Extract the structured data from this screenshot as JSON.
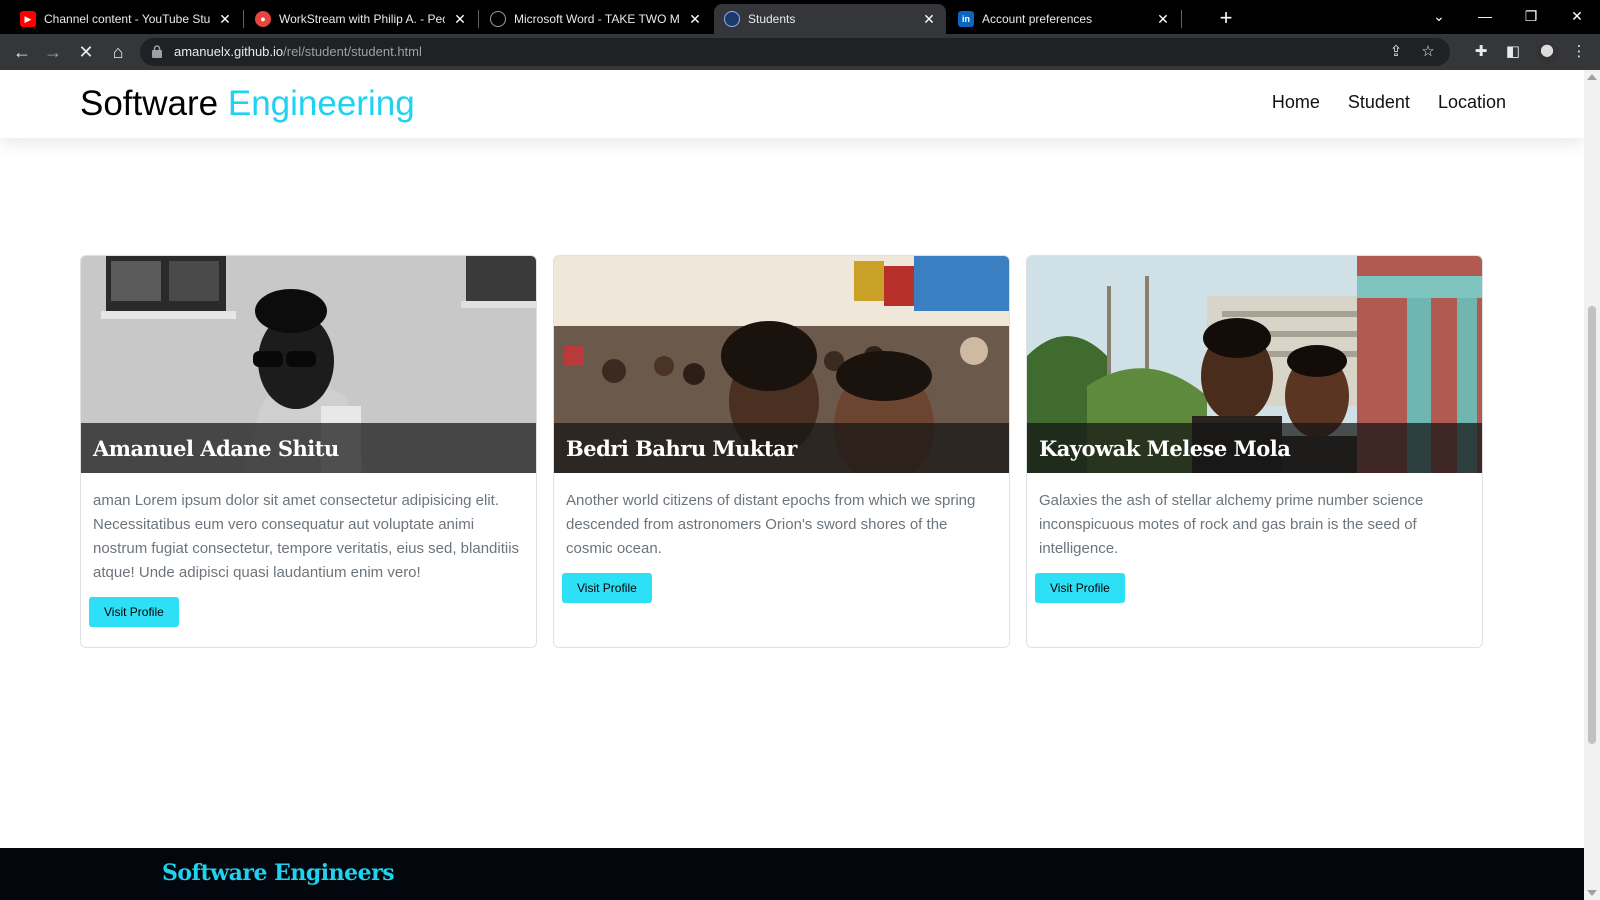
{
  "browser": {
    "tabs": [
      {
        "title": "Channel content - YouTube Studio",
        "favicon": "youtube-icon",
        "color": "#ff0000",
        "active": false
      },
      {
        "title": "WorkStream with Philip A. - People",
        "favicon": "workstream-icon",
        "color": "#e8453c",
        "active": false
      },
      {
        "title": "Microsoft Word - TAKE TWO MAIN",
        "favicon": "globe-icon",
        "color": "#9aa0a6",
        "active": false
      },
      {
        "title": "Students",
        "favicon": "page-icon",
        "color": "#8ab4f8",
        "active": true
      },
      {
        "title": "Account preferences",
        "favicon": "linkedin-icon",
        "color": "#0a66c2",
        "active": false
      }
    ],
    "url_host": "amanuelx.github.io",
    "url_path": "/rel/student/student.html"
  },
  "site": {
    "brand_main": "Software",
    "brand_accent": "Engineering",
    "accent_color": "#1ed2f0",
    "nav": [
      "Home",
      "Student",
      "Location"
    ]
  },
  "students": [
    {
      "name": "Amanuel Adane Shitu",
      "bio": "aman Lorem ipsum dolor sit amet consectetur adipisicing elit. Necessitatibus eum vero consequatur aut voluptate animi nostrum fugiat consectetur, tempore veritatis, eius sed, blanditiis atque! Unde adipisci quasi laudantium enim vero!",
      "button": "Visit Profile"
    },
    {
      "name": "Bedri Bahru Muktar",
      "bio": "Another world citizens of distant epochs from which we spring descended from astronomers Orion's sword shores of the cosmic ocean.",
      "button": "Visit Profile"
    },
    {
      "name": "Kayowak Melese Mola",
      "bio": "Galaxies the ash of stellar alchemy prime number science inconspicuous motes of rock and gas brain is the seed of intelligence.",
      "button": "Visit Profile"
    }
  ],
  "footer": {
    "title": "Software Engineers"
  }
}
